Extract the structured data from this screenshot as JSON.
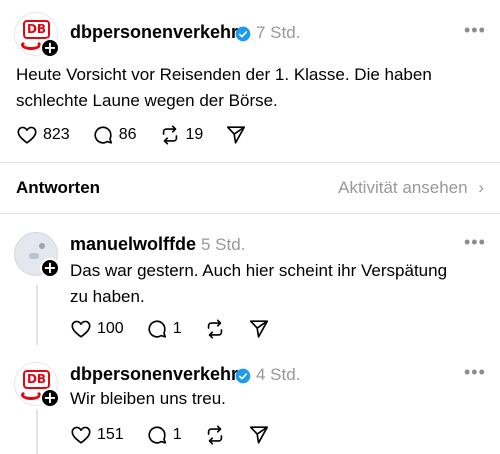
{
  "main_post": {
    "username": "dbpersonenverkehr",
    "time": "7 Std.",
    "text_line1": "Heute Vorsicht vor Reisenden der 1. Klasse. Die haben",
    "text_line2": "schlechte Laune wegen der Börse.",
    "likes": "823",
    "replies": "86",
    "reposts": "19"
  },
  "replies_section": {
    "title": "Antworten",
    "activity_link": "Aktivität ansehen"
  },
  "reply1": {
    "username": "manuelwolffde",
    "time": "5 Std.",
    "text_line1": "Das war gestern. Auch hier scheint ihr Verspätung",
    "text_line2": "zu haben.",
    "likes": "100",
    "replies": "1"
  },
  "reply2": {
    "username": "dbpersonenverkehr",
    "time": "4 Std.",
    "text_line1": "Wir bleiben uns treu.",
    "likes": "151",
    "replies": "1"
  },
  "db_logo_text": "DB",
  "colors": {
    "verified": "#1d9bf0",
    "db_red": "#e30613",
    "muted": "#999999"
  }
}
